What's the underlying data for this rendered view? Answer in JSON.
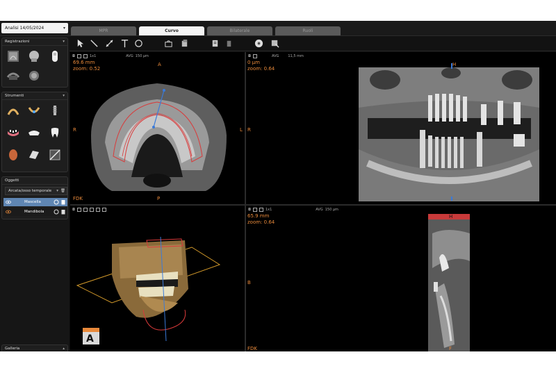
{
  "header": {
    "analysis": "Analisi 14/05/2024",
    "tabs": [
      {
        "label": "MPR",
        "active": false
      },
      {
        "label": "Curvo",
        "active": true
      },
      {
        "label": "Bilaterale",
        "active": false
      },
      {
        "label": "Ruoli",
        "active": false
      }
    ]
  },
  "sidebar": {
    "registrations_title": "Registrazioni",
    "tools_title": "Strumenti",
    "objects_title": "Oggetti",
    "objects_dropdown": "Arcata/osso temporale",
    "objects": [
      {
        "label": "Mascella",
        "selected": true
      },
      {
        "label": "Mandibola",
        "selected": false
      }
    ],
    "gallery_title": "Galleria"
  },
  "viewports": {
    "axial": {
      "measure": "69.6 mm",
      "zoom": "zoom: 0.52",
      "top": "A",
      "left": "R",
      "right": "L",
      "bottom": "P",
      "corner": "FDK",
      "mode": "AVG",
      "thickness": "150 µm",
      "scale": "1x1"
    },
    "panoramic": {
      "measure": "0 µm",
      "zoom": "zoom: 0.64",
      "left": "R",
      "top": "H",
      "bottom": "F",
      "mode": "AVG",
      "thickness": "11,5 mm"
    },
    "volume": {
      "cube_label": "A"
    },
    "cross": {
      "measure": "65.9 mm",
      "zoom": "zoom: 0.64",
      "left": "B",
      "corner": "FDK",
      "top": "H",
      "bottom": "F",
      "mode": "AVG",
      "thickness": "150 µm",
      "scale": "1x1"
    }
  },
  "colors": {
    "accent": "#e8893a",
    "selection": "#5f86b3",
    "red_curve": "#d93a3a",
    "blue_axis": "#3a7ad9"
  }
}
